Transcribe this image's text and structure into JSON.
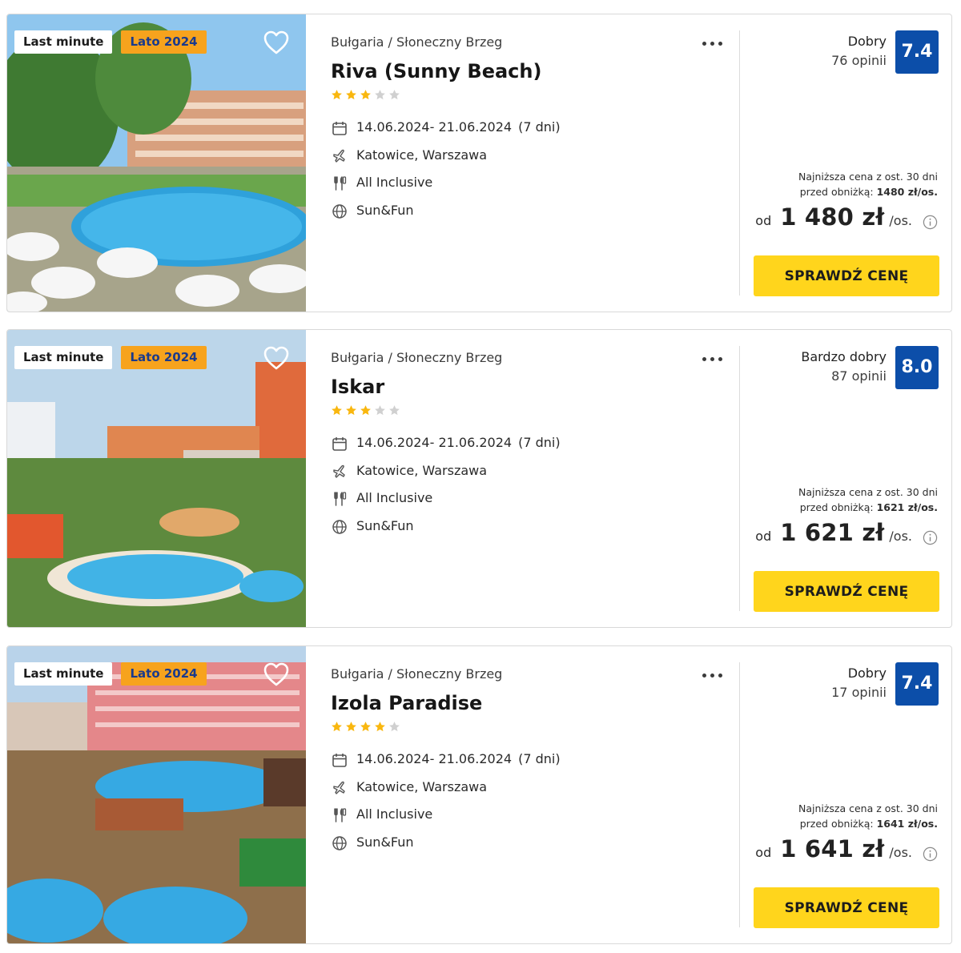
{
  "colors": {
    "score_bg": "#0c4ea9",
    "cta_bg": "#ffd51c",
    "badge_season_bg": "#f7a31d",
    "badge_season_text": "#1a3a8c",
    "star_filled": "#f9b70f",
    "star_empty": "#d0d0d0"
  },
  "offers": [
    {
      "badges": {
        "last_minute": "Last minute",
        "season": "Lato 2024"
      },
      "photo": "pool-hotel-photo",
      "location": "Bułgaria / Słoneczny Brzeg",
      "name": "Riva (Sunny Beach)",
      "stars": 3,
      "max_stars": 5,
      "dates": "14.06.2024- 21.06.2024",
      "duration": "(7 dni)",
      "departure": "Katowice, Warszawa",
      "board": "All Inclusive",
      "category": "Sun&Fun",
      "rating_label": "Dobry",
      "reviews": "76 opinii",
      "score": "7.4",
      "lowest_line1": "Najniższa cena z ost. 30 dni",
      "lowest_line2_prefix": "przed obniżką:",
      "lowest_price": "1480 zł/os.",
      "price_prefix": "od",
      "price": "1 480 zł",
      "price_unit": "/os.",
      "cta": "SPRAWDŹ CENĘ"
    },
    {
      "badges": {
        "last_minute": "Last minute",
        "season": "Lato 2024"
      },
      "photo": "pool-hotel-photo",
      "location": "Bułgaria / Słoneczny Brzeg",
      "name": "Iskar",
      "stars": 3,
      "max_stars": 5,
      "dates": "14.06.2024- 21.06.2024",
      "duration": "(7 dni)",
      "departure": "Katowice, Warszawa",
      "board": "All Inclusive",
      "category": "Sun&Fun",
      "rating_label": "Bardzo dobry",
      "reviews": "87 opinii",
      "score": "8.0",
      "lowest_line1": "Najniższa cena z ost. 30 dni",
      "lowest_line2_prefix": "przed obniżką:",
      "lowest_price": "1621 zł/os.",
      "price_prefix": "od",
      "price": "1 621 zł",
      "price_unit": "/os.",
      "cta": "SPRAWDŹ CENĘ"
    },
    {
      "badges": {
        "last_minute": "Last minute",
        "season": "Lato 2024"
      },
      "photo": "pool-hotel-photo",
      "location": "Bułgaria / Słoneczny Brzeg",
      "name": "Izola Paradise",
      "stars": 4,
      "max_stars": 5,
      "dates": "14.06.2024- 21.06.2024",
      "duration": "(7 dni)",
      "departure": "Katowice, Warszawa",
      "board": "All Inclusive",
      "category": "Sun&Fun",
      "rating_label": "Dobry",
      "reviews": "17 opinii",
      "score": "7.4",
      "lowest_line1": "Najniższa cena z ost. 30 dni",
      "lowest_line2_prefix": "przed obniżką:",
      "lowest_price": "1641 zł/os.",
      "price_prefix": "od",
      "price": "1 641 zł",
      "price_unit": "/os.",
      "cta": "SPRAWDŹ CENĘ"
    }
  ]
}
